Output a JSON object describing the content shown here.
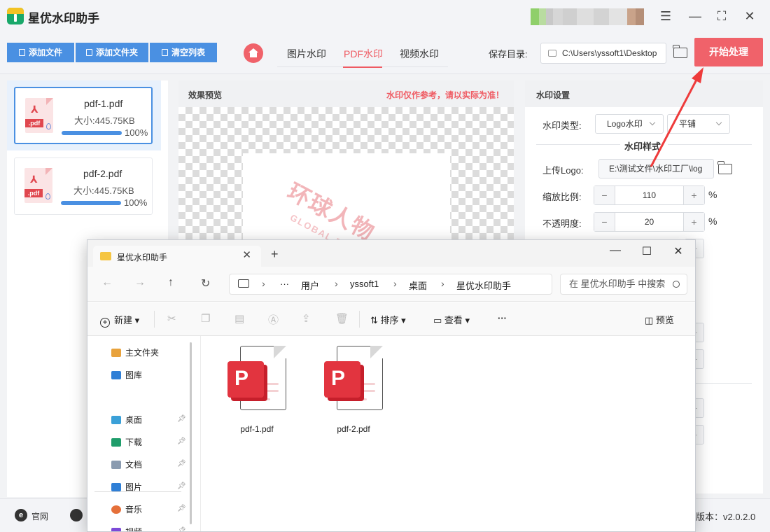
{
  "app": {
    "title": "星优水印助手",
    "colors": {
      "accent": "#4a90e2",
      "brand_red": "#f0626a",
      "start_button": "#f0626a"
    }
  },
  "window_controls": {
    "settings": "☰",
    "minimize": "—",
    "maximize": "⛶",
    "close": "✕"
  },
  "toolbar": {
    "add_file": "添加文件",
    "add_folder": "添加文件夹",
    "clear_list": "清空列表",
    "tabs": [
      "图片水印",
      "PDF水印",
      "视频水印"
    ],
    "active_tab": "PDF水印",
    "save_label": "保存目录:",
    "save_path": "C:\\Users\\yssoft1\\Desktop",
    "start_button": "开始处理"
  },
  "file_list": [
    {
      "name": "pdf-1.pdf",
      "size": "大小:445.75KB",
      "progress_label": "100%",
      "progress": 1.0,
      "selected": true
    },
    {
      "name": "pdf-2.pdf",
      "size": "大小:445.75KB",
      "progress_label": "100%",
      "progress": 1.0,
      "selected": false
    }
  ],
  "preview": {
    "title": "效果预览",
    "note": "水印仅作参考，请以实际为准！",
    "watermark_text": "环球人物",
    "watermark_sub": "GLOBAL PEOPLE"
  },
  "settings": {
    "title": "水印设置",
    "type_label": "水印类型:",
    "type_value": "Logo水印",
    "layout_value": "平铺",
    "section_title": "水印样式",
    "upload_label": "上传Logo:",
    "upload_path": "E:\\测试文件\\水印工厂\\log",
    "scale_label": "缩放比例:",
    "scale_value": "110",
    "scale_unit": "%",
    "opacity_label": "不透明度:",
    "opacity_value": "20",
    "opacity_unit": "%",
    "minus": "−",
    "plus": "+"
  },
  "statusbar": {
    "website": "官网",
    "website_icon": "e",
    "version": "版本：v2.0.2.0"
  },
  "explorer": {
    "tab_title": "星优水印助手",
    "tab_close": "✕",
    "new_tab": "+",
    "controls": {
      "minimize": "—",
      "maximize": "☐",
      "close": "✕"
    },
    "nav": {
      "back": "←",
      "forward": "→",
      "up": "↑",
      "refresh": "↻"
    },
    "breadcrumb": [
      "用户",
      "yssoft1",
      "桌面",
      "星优水印助手"
    ],
    "breadcrumb_more": "···",
    "breadcrumb_sep": "›",
    "search_placeholder": "在 星优水印助手 中搜索",
    "commands": {
      "new": "新建",
      "sort": "排序",
      "view": "查看",
      "more": "···",
      "preview": "预览"
    },
    "sidebar": [
      {
        "label": "主文件夹",
        "icon": "home-icon",
        "pinned": false
      },
      {
        "label": "图库",
        "icon": "gallery-icon",
        "pinned": false
      },
      {
        "label": "桌面",
        "icon": "desktop-icon",
        "pinned": true
      },
      {
        "label": "下载",
        "icon": "download-icon",
        "pinned": true
      },
      {
        "label": "文档",
        "icon": "document-icon",
        "pinned": true
      },
      {
        "label": "图片",
        "icon": "pictures-icon",
        "pinned": true
      },
      {
        "label": "音乐",
        "icon": "music-icon",
        "pinned": true
      },
      {
        "label": "视频",
        "icon": "video-icon",
        "pinned": true
      }
    ],
    "files": [
      {
        "name": "pdf-1.pdf",
        "icon": "pdf-icon"
      },
      {
        "name": "pdf-2.pdf",
        "icon": "pdf-icon"
      }
    ]
  }
}
